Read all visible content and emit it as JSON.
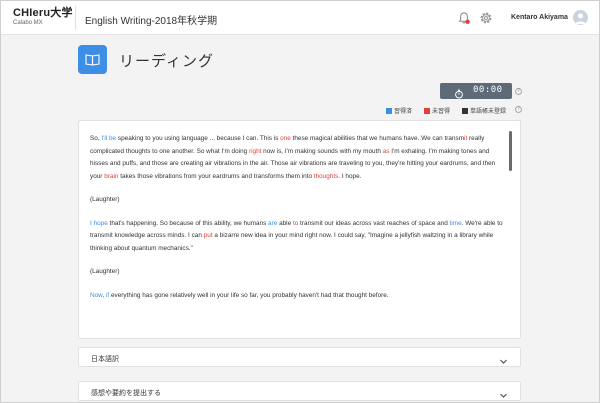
{
  "header": {
    "brand_name": "CHIeru大学",
    "brand_sub": "Calabo MX",
    "course_title": "English Writing-2018年秋学期",
    "user_name": "Kentaro Akiyama",
    "icons": [
      "bell-icon",
      "gear-icon",
      "avatar"
    ]
  },
  "page": {
    "title": "リーディング",
    "icon": "book-icon"
  },
  "timer": {
    "value": "00:00",
    "icon": "stopwatch-icon"
  },
  "legend": [
    {
      "label": "習得済",
      "color": "#3d8fe6"
    },
    {
      "label": "未習得",
      "color": "#e0413e"
    },
    {
      "label": "単語帳未登録",
      "color": "#333333"
    }
  ],
  "reading": {
    "p1": {
      "s01": "So, ",
      "s02": "I'll",
      "s03": " ",
      "s04": "be",
      "s05": " speaking to you using language ... because I can. This is ",
      "s06": "one",
      "s07": " these magical abilities that we humans have. We can transm",
      "s08": "it",
      "s09": " really complicated thoughts to one another. So what I'm doing ",
      "s10": "right",
      "s11": " now is, I'm making sounds with my mouth ",
      "s12": "as",
      "s13": " I'm exhaling. I'm making tones and hisses and puffs, and those are creating air vibrations in the air. Those air vibrations are traveling to you, they're hitting your eardrums, and then your ",
      "s14": "brain",
      "s15": " takes those vibrations from your eardrums and transforms them into ",
      "s16": "thoughts",
      "s17": ". I hope."
    },
    "p2": "(Laughter)",
    "p3": {
      "s01": "I",
      "s02": " ",
      "s03": "hope",
      "s04": " that's happening. So because of this ability, we humans ",
      "s05": "are",
      "s06": " able ",
      "s07": "to",
      "s08": " transmit our ideas across vast reaches of space and ",
      "s09": "time",
      "s10": ". We're able to transmit knowledge across minds. I can ",
      "s11": "put",
      "s12": " a bizarre new idea in your mind right now. I could say, \"Imagine a jellyfish waltzing in a library while thinking about quantum mechanics.\""
    },
    "p4": "(Laughter)",
    "p5": {
      "s01": "Now",
      "s02": ", ",
      "s03": "if",
      "s04": " everything has gone relatively well in your life so far, you probably haven't had that thought before."
    }
  },
  "accordions": [
    {
      "label": "日本語訳"
    },
    {
      "label": "感想や要約を提出する"
    }
  ]
}
